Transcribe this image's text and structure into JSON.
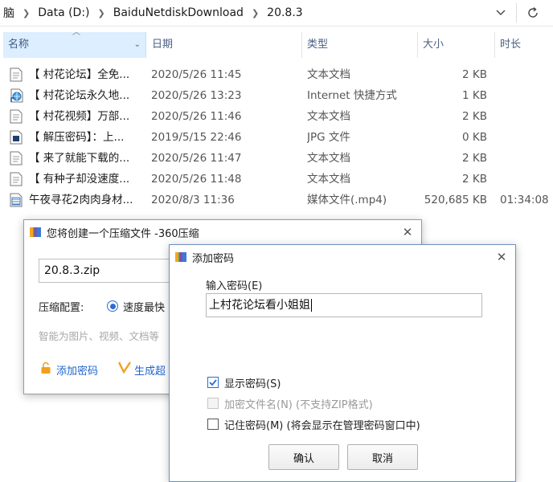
{
  "explorer": {
    "breadcrumbs": [
      "脑",
      "Data (D:)",
      "BaiduNetdiskDownload",
      "20.8.3"
    ],
    "columns": {
      "name": "名称",
      "date": "日期",
      "type": "类型",
      "size": "大小",
      "duration": "时长"
    },
    "files": [
      {
        "name": "【 村花论坛】全免...",
        "date": "2020/5/26 11:45",
        "type": "文本文档",
        "size": "2 KB",
        "duration": "",
        "icon": "text-file-icon"
      },
      {
        "name": "【 村花论坛永久地...",
        "date": "2020/5/26 13:23",
        "type": "Internet 快捷方式",
        "size": "1 KB",
        "duration": "",
        "icon": "internet-shortcut-icon"
      },
      {
        "name": "【 村花视频】万部...",
        "date": "2020/5/26 11:46",
        "type": "文本文档",
        "size": "2 KB",
        "duration": "",
        "icon": "text-file-icon"
      },
      {
        "name": "【 解压密码】：上...",
        "date": "2019/5/15 22:46",
        "type": "JPG 文件",
        "size": "0 KB",
        "duration": "",
        "icon": "image-file-icon"
      },
      {
        "name": "【 来了就能下载的...",
        "date": "2020/5/26 11:47",
        "type": "文本文档",
        "size": "2 KB",
        "duration": "",
        "icon": "text-file-icon"
      },
      {
        "name": "【 有种子却没速度...",
        "date": "2020/5/26 11:48",
        "type": "文本文档",
        "size": "2 KB",
        "duration": "",
        "icon": "text-file-icon"
      },
      {
        "name": "午夜寻花2肉肉身材...",
        "date": "2020/8/3 11:36",
        "type": "媒体文件(.mp4)",
        "size": "520,685 KB",
        "duration": "01:34:08",
        "icon": "video-file-icon"
      }
    ]
  },
  "zip_dialog": {
    "title": "您将创建一个压缩文件 -360压缩",
    "filename": "20.8.3.zip",
    "config_label": "压缩配置:",
    "speed_option": "速度最快",
    "hint": "智能为图片、视频、文档等",
    "add_password": "添加密码",
    "generate": "生成超"
  },
  "password_dialog": {
    "title": "添加密码",
    "input_label": "输入密码(E)",
    "password_value": "上村花论坛看小姐姐",
    "show_password": "显示密码(S)",
    "encrypt_filenames": "加密文件名(N) (不支持ZIP格式)",
    "remember_password": "记住密码(M) (将会显示在管理密码窗口中)",
    "ok": "确认",
    "cancel": "取消",
    "show_password_checked": true,
    "encrypt_filenames_enabled": false,
    "remember_password_checked": false
  },
  "colors": {
    "accent": "#2b6cd4",
    "header_selected": "#dceeff",
    "link": "#2266cc"
  }
}
